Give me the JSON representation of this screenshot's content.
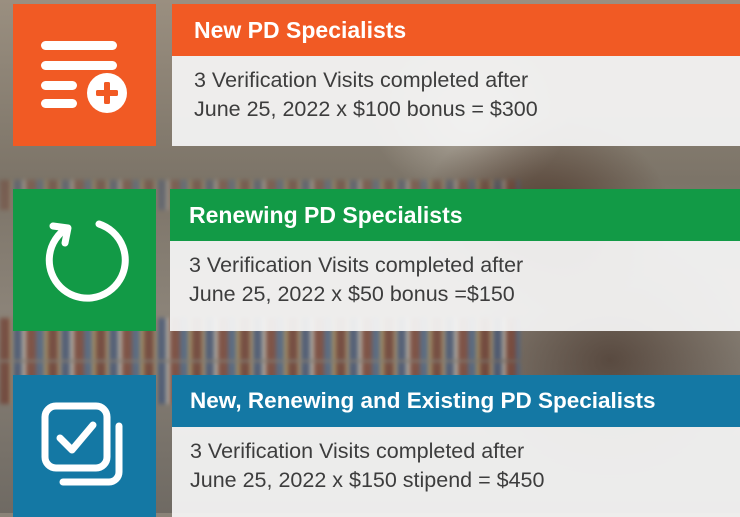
{
  "colors": {
    "orange": "#f15a24",
    "green": "#129a46",
    "blue": "#1478a4"
  },
  "cards": [
    {
      "icon": "list-add-icon",
      "title": "New PD Specialists",
      "line1": "3 Verification Visits completed after",
      "line2": "June 25, 2022 x $100 bonus = $300"
    },
    {
      "icon": "refresh-icon",
      "title": "Renewing PD Specialists",
      "line1": "3 Verification Visits completed after",
      "line2": "June 25, 2022 x $50 bonus =$150"
    },
    {
      "icon": "checkbox-stack-icon",
      "title": "New, Renewing and Existing PD Specialists",
      "line1": "3 Verification Visits completed after",
      "line2": "June 25, 2022 x $150 stipend = $450"
    }
  ]
}
